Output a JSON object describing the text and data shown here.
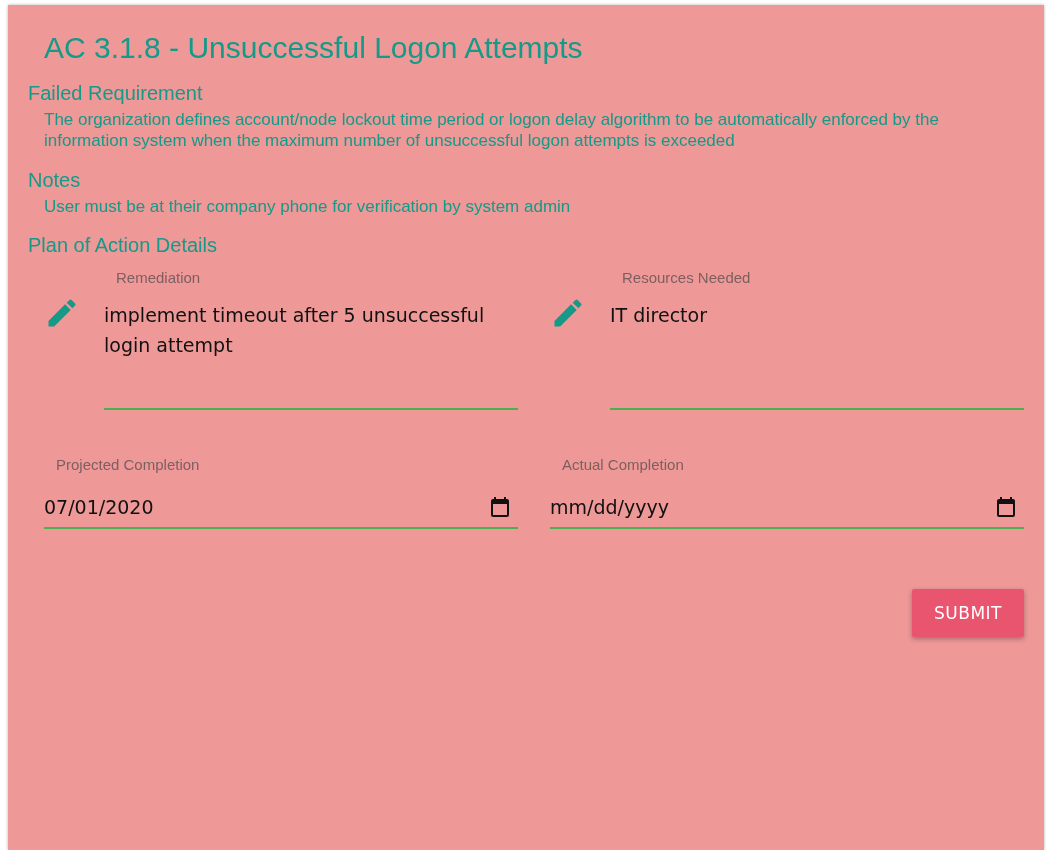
{
  "title": "AC 3.1.8 - Unsuccessful Logon Attempts",
  "sections": [
    {
      "heading": "Failed Requirement",
      "text": "The organization defines account/node lockout time period or logon delay algorithm to be automatically enforced by the information system when the maximum number of unsuccessful logon attempts is exceeded"
    },
    {
      "heading": "Notes",
      "text": "User must be at their company phone for verification by system admin"
    }
  ],
  "plan": {
    "heading": "Plan of Action Details",
    "text_fields": [
      {
        "label": "Remediation",
        "value": "implement timeout after 5 unsuccessful login attempt"
      },
      {
        "label": "Resources Needed",
        "value": "IT director"
      }
    ],
    "date_fields": [
      {
        "label": "Projected Completion",
        "value": "07/01/2020"
      },
      {
        "label": "Actual Completion",
        "placeholder": "mm/dd/yyyy"
      }
    ]
  },
  "submit": "SUBMIT"
}
